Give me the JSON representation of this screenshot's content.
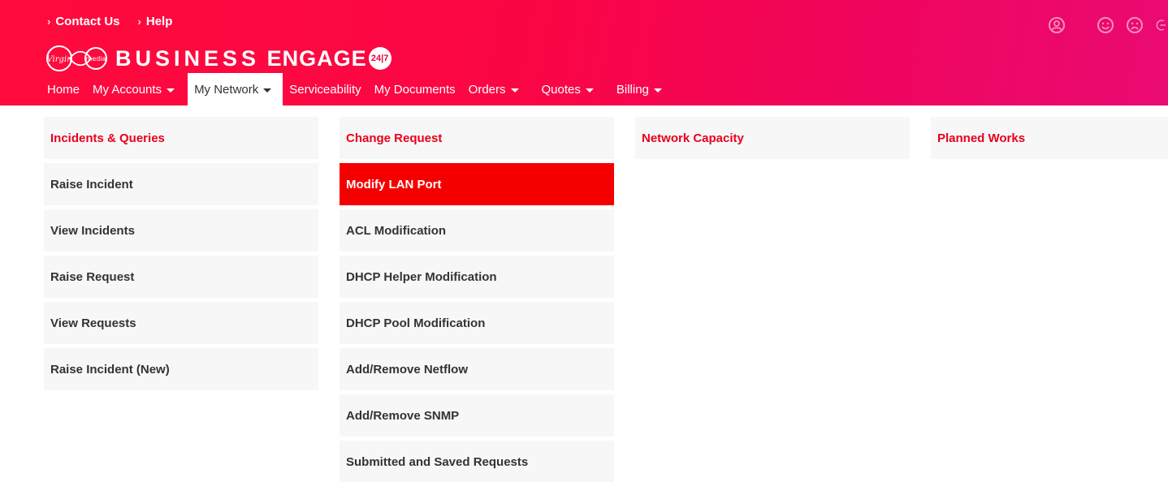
{
  "header": {
    "top_links": [
      {
        "label": "Contact Us"
      },
      {
        "label": "Help"
      }
    ],
    "brand": {
      "logo_text": "Virgin media",
      "title_part1": "BUSINESS",
      "title_part2": "ENGAGE",
      "badge": "24|7"
    },
    "icons": [
      "user-icon",
      "smiley-icon",
      "sad-face-icon",
      "logout-icon"
    ]
  },
  "nav": {
    "items": [
      {
        "label": "Home",
        "dropdown": false
      },
      {
        "label": "My Accounts",
        "dropdown": true
      },
      {
        "label": "My Network",
        "dropdown": true,
        "active": true
      },
      {
        "label": "Serviceability",
        "dropdown": false
      },
      {
        "label": "My Documents",
        "dropdown": false
      },
      {
        "label": "Orders",
        "dropdown": true
      },
      {
        "label": "Quotes",
        "dropdown": true
      },
      {
        "label": "Billing",
        "dropdown": true
      }
    ]
  },
  "menu": {
    "columns": [
      {
        "heading": "Incidents & Queries",
        "items": [
          "Raise Incident",
          "View Incidents",
          "Raise Request",
          "View Requests",
          "Raise Incident (New)"
        ]
      },
      {
        "heading": "Change Request",
        "items": [
          "Modify LAN Port",
          "ACL Modification",
          "DHCP Helper Modification",
          "DHCP Pool Modification",
          "Add/Remove Netflow",
          "Add/Remove SNMP",
          "Submitted and Saved Requests"
        ],
        "highlighted_item": "Modify LAN Port"
      },
      {
        "heading": "Network Capacity",
        "items": []
      },
      {
        "heading": "Planned Works",
        "items": []
      }
    ]
  },
  "colors": {
    "brand_red": "#ff0a3c",
    "brand_magenta": "#ea0a73",
    "heading_red": "#e8001c",
    "highlight_red": "#f50000",
    "cell_bg": "#f7f7f7"
  }
}
